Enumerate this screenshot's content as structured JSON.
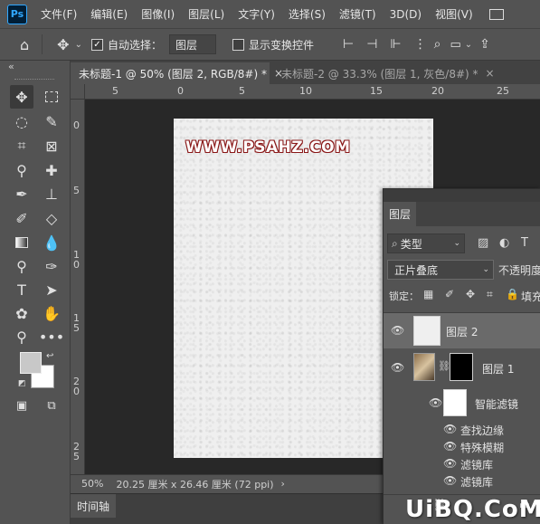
{
  "menubar": {
    "logo": "Ps",
    "items": [
      "文件(F)",
      "编辑(E)",
      "图像(I)",
      "图层(L)",
      "文字(Y)",
      "选择(S)",
      "滤镜(T)",
      "3D(D)",
      "视图(V)"
    ]
  },
  "options": {
    "auto_select_label": "自动选择：",
    "auto_select_target": "图层",
    "show_transform_label": "显示变换控件"
  },
  "tabs": [
    {
      "label": "未标题-1 @ 50% (图层 2, RGB/8#) *",
      "close": "×"
    },
    {
      "label": "未标题-2 @ 33.3% (图层 1, 灰色/8#) *",
      "close": "×"
    }
  ],
  "collapse_arrows": "«",
  "ruler_top": [
    "5",
    "0",
    "5",
    "10",
    "15",
    "20",
    "25"
  ],
  "ruler_left": [
    "0",
    "5",
    "1 0",
    "1 5",
    "2 0",
    "2 5"
  ],
  "canvas": {
    "watermark": "WWW.PSAHZ.COM"
  },
  "status": {
    "zoom": "50%",
    "doc_size": "20.25 厘米 x 26.46 厘米 (72 ppi)",
    "arrow": "›"
  },
  "timeline": {
    "label": "时间轴"
  },
  "layers_panel": {
    "tab_label": "图层",
    "filter_kind": "类型",
    "blend_mode": "正片叠底",
    "opacity_label": "不透明度",
    "lock_label": "锁定：",
    "fill_label": "填充",
    "layers": [
      {
        "name": "图层 2",
        "selected": true
      },
      {
        "name": "图层 1",
        "selected": false
      }
    ],
    "smart_filters_label": "智能滤镜",
    "filters": [
      "查找边缘",
      "特殊模糊",
      "滤镜库",
      "滤镜库"
    ]
  },
  "brand_logo": "UiBQ.CoM",
  "colors": {
    "ui_bg": "#535353",
    "workspace": "#282828",
    "canvas": "#efefef",
    "watermark_outline": "#8a1818",
    "selected_layer": "#6a6a6a"
  }
}
